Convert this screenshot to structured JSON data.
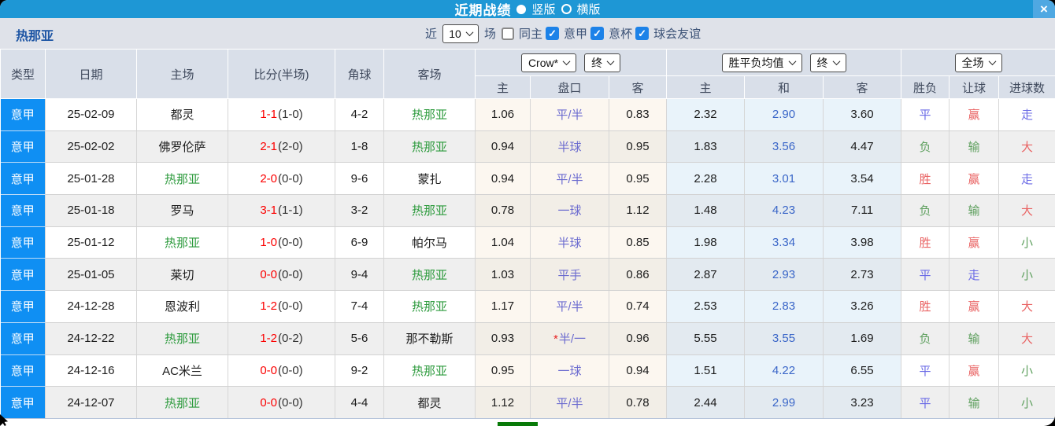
{
  "glyphs": {
    "check": "✓",
    "close": "×",
    "star": "*"
  },
  "colors": {
    "titlebar_blue": "#1e97d5",
    "league_blue": "#0f8ff3",
    "focus_green": "#2e9b3e",
    "score_red": "#fb0000",
    "handicap_purple": "#6b6bcf",
    "draw_odds_blue": "#3a66c8",
    "result_red": "#e96363",
    "result_green": "#5fa05f",
    "result_blue": "#6b6be6",
    "filterbar_bg": "#dfe2e9",
    "header_bg": "#d9dfe9",
    "checkbox_blue": "#1c82e8"
  },
  "titlebar": {
    "title": "近期战绩",
    "radio_vertical": "竖版",
    "radio_horizontal": "横版",
    "vertical_selected": true
  },
  "filterbar": {
    "team": "热那亚",
    "near_label": "近",
    "count_value": "10",
    "games_label": "场",
    "checkboxes": [
      {
        "id": "same-home",
        "label": "同主",
        "checked": false
      },
      {
        "id": "serie-a",
        "label": "意甲",
        "checked": true
      },
      {
        "id": "italy-cup",
        "label": "意杯",
        "checked": true
      },
      {
        "id": "club-friendly",
        "label": "球会友谊",
        "checked": true
      }
    ]
  },
  "table": {
    "main_headers": [
      "类型",
      "日期",
      "主场",
      "比分(半场)",
      "角球",
      "客场"
    ],
    "controls": {
      "bookmaker": "Crow*",
      "bookmaker_time": "终",
      "odds_type": "胜平负均值",
      "odds_time": "终",
      "scope": "全场"
    },
    "sub_headers": [
      "主",
      "盘口",
      "客",
      "主",
      "和",
      "客",
      "胜负",
      "让球",
      "进球数"
    ],
    "rows": [
      {
        "league": "意甲",
        "date": "25-02-09",
        "home": "都灵",
        "home_focus": false,
        "score": "1-1",
        "half": "(1-0)",
        "corners": "4-2",
        "away": "热那亚",
        "away_focus": true,
        "ah_home": "1.06",
        "ah_line": "平/半",
        "ah_star": false,
        "ah_away": "0.83",
        "odds_home": "2.32",
        "odds_draw": "2.90",
        "odds_away": "3.60",
        "result_wdl": {
          "text": "平",
          "color": "blue"
        },
        "result_handicap": {
          "text": "赢",
          "color": "red"
        },
        "result_goals": {
          "text": "走",
          "color": "blue"
        }
      },
      {
        "league": "意甲",
        "date": "25-02-02",
        "home": "佛罗伦萨",
        "home_focus": false,
        "score": "2-1",
        "half": "(2-0)",
        "corners": "1-8",
        "away": "热那亚",
        "away_focus": true,
        "ah_home": "0.94",
        "ah_line": "半球",
        "ah_star": false,
        "ah_away": "0.95",
        "odds_home": "1.83",
        "odds_draw": "3.56",
        "odds_away": "4.47",
        "result_wdl": {
          "text": "负",
          "color": "green"
        },
        "result_handicap": {
          "text": "输",
          "color": "green"
        },
        "result_goals": {
          "text": "大",
          "color": "red"
        }
      },
      {
        "league": "意甲",
        "date": "25-01-28",
        "home": "热那亚",
        "home_focus": true,
        "score": "2-0",
        "half": "(0-0)",
        "corners": "9-6",
        "away": "蒙扎",
        "away_focus": false,
        "ah_home": "0.94",
        "ah_line": "平/半",
        "ah_star": false,
        "ah_away": "0.95",
        "odds_home": "2.28",
        "odds_draw": "3.01",
        "odds_away": "3.54",
        "result_wdl": {
          "text": "胜",
          "color": "red"
        },
        "result_handicap": {
          "text": "赢",
          "color": "red"
        },
        "result_goals": {
          "text": "走",
          "color": "blue"
        }
      },
      {
        "league": "意甲",
        "date": "25-01-18",
        "home": "罗马",
        "home_focus": false,
        "score": "3-1",
        "half": "(1-1)",
        "corners": "3-2",
        "away": "热那亚",
        "away_focus": true,
        "ah_home": "0.78",
        "ah_line": "一球",
        "ah_star": false,
        "ah_away": "1.12",
        "odds_home": "1.48",
        "odds_draw": "4.23",
        "odds_away": "7.11",
        "result_wdl": {
          "text": "负",
          "color": "green"
        },
        "result_handicap": {
          "text": "输",
          "color": "green"
        },
        "result_goals": {
          "text": "大",
          "color": "red"
        }
      },
      {
        "league": "意甲",
        "date": "25-01-12",
        "home": "热那亚",
        "home_focus": true,
        "score": "1-0",
        "half": "(0-0)",
        "corners": "6-9",
        "away": "帕尔马",
        "away_focus": false,
        "ah_home": "1.04",
        "ah_line": "半球",
        "ah_star": false,
        "ah_away": "0.85",
        "odds_home": "1.98",
        "odds_draw": "3.34",
        "odds_away": "3.98",
        "result_wdl": {
          "text": "胜",
          "color": "red"
        },
        "result_handicap": {
          "text": "赢",
          "color": "red"
        },
        "result_goals": {
          "text": "小",
          "color": "green"
        }
      },
      {
        "league": "意甲",
        "date": "25-01-05",
        "home": "莱切",
        "home_focus": false,
        "score": "0-0",
        "half": "(0-0)",
        "corners": "9-4",
        "away": "热那亚",
        "away_focus": true,
        "ah_home": "1.03",
        "ah_line": "平手",
        "ah_star": false,
        "ah_away": "0.86",
        "odds_home": "2.87",
        "odds_draw": "2.93",
        "odds_away": "2.73",
        "result_wdl": {
          "text": "平",
          "color": "blue"
        },
        "result_handicap": {
          "text": "走",
          "color": "blue"
        },
        "result_goals": {
          "text": "小",
          "color": "green"
        }
      },
      {
        "league": "意甲",
        "date": "24-12-28",
        "home": "恩波利",
        "home_focus": false,
        "score": "1-2",
        "half": "(0-0)",
        "corners": "7-4",
        "away": "热那亚",
        "away_focus": true,
        "ah_home": "1.17",
        "ah_line": "平/半",
        "ah_star": false,
        "ah_away": "0.74",
        "odds_home": "2.53",
        "odds_draw": "2.83",
        "odds_away": "3.26",
        "result_wdl": {
          "text": "胜",
          "color": "red"
        },
        "result_handicap": {
          "text": "赢",
          "color": "red"
        },
        "result_goals": {
          "text": "大",
          "color": "red"
        }
      },
      {
        "league": "意甲",
        "date": "24-12-22",
        "home": "热那亚",
        "home_focus": true,
        "score": "1-2",
        "half": "(0-2)",
        "corners": "5-6",
        "away": "那不勒斯",
        "away_focus": false,
        "ah_home": "0.93",
        "ah_line": "半/一",
        "ah_star": true,
        "ah_away": "0.96",
        "odds_home": "5.55",
        "odds_draw": "3.55",
        "odds_away": "1.69",
        "result_wdl": {
          "text": "负",
          "color": "green"
        },
        "result_handicap": {
          "text": "输",
          "color": "green"
        },
        "result_goals": {
          "text": "大",
          "color": "red"
        }
      },
      {
        "league": "意甲",
        "date": "24-12-16",
        "home": "AC米兰",
        "home_focus": false,
        "score": "0-0",
        "half": "(0-0)",
        "corners": "9-2",
        "away": "热那亚",
        "away_focus": true,
        "ah_home": "0.95",
        "ah_line": "一球",
        "ah_star": false,
        "ah_away": "0.94",
        "odds_home": "1.51",
        "odds_draw": "4.22",
        "odds_away": "6.55",
        "result_wdl": {
          "text": "平",
          "color": "blue"
        },
        "result_handicap": {
          "text": "赢",
          "color": "red"
        },
        "result_goals": {
          "text": "小",
          "color": "green"
        }
      },
      {
        "league": "意甲",
        "date": "24-12-07",
        "home": "热那亚",
        "home_focus": true,
        "score": "0-0",
        "half": "(0-0)",
        "corners": "4-4",
        "away": "都灵",
        "away_focus": false,
        "ah_home": "1.12",
        "ah_line": "平/半",
        "ah_star": false,
        "ah_away": "0.78",
        "odds_home": "2.44",
        "odds_draw": "2.99",
        "odds_away": "3.23",
        "result_wdl": {
          "text": "平",
          "color": "blue"
        },
        "result_handicap": {
          "text": "输",
          "color": "green"
        },
        "result_goals": {
          "text": "小",
          "color": "green"
        }
      }
    ]
  }
}
